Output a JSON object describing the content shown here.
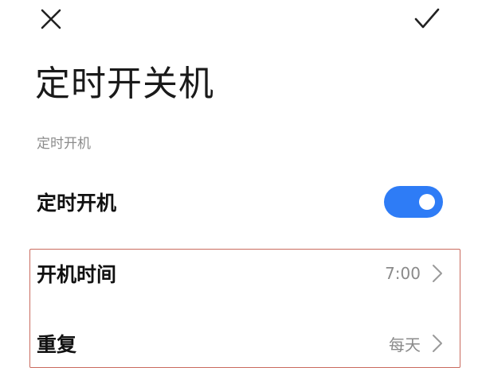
{
  "header": {
    "close_icon": "close-icon",
    "confirm_icon": "checkmark-icon"
  },
  "page": {
    "title": "定时开关机"
  },
  "section": {
    "label": "定时开机"
  },
  "toggle_row": {
    "label": "定时开机",
    "enabled": true,
    "accent_color": "#2e7cf6"
  },
  "settings": [
    {
      "label": "开机时间",
      "value": "7:00"
    },
    {
      "label": "重复",
      "value": "每天"
    }
  ],
  "highlight_color": "#c96a5e"
}
